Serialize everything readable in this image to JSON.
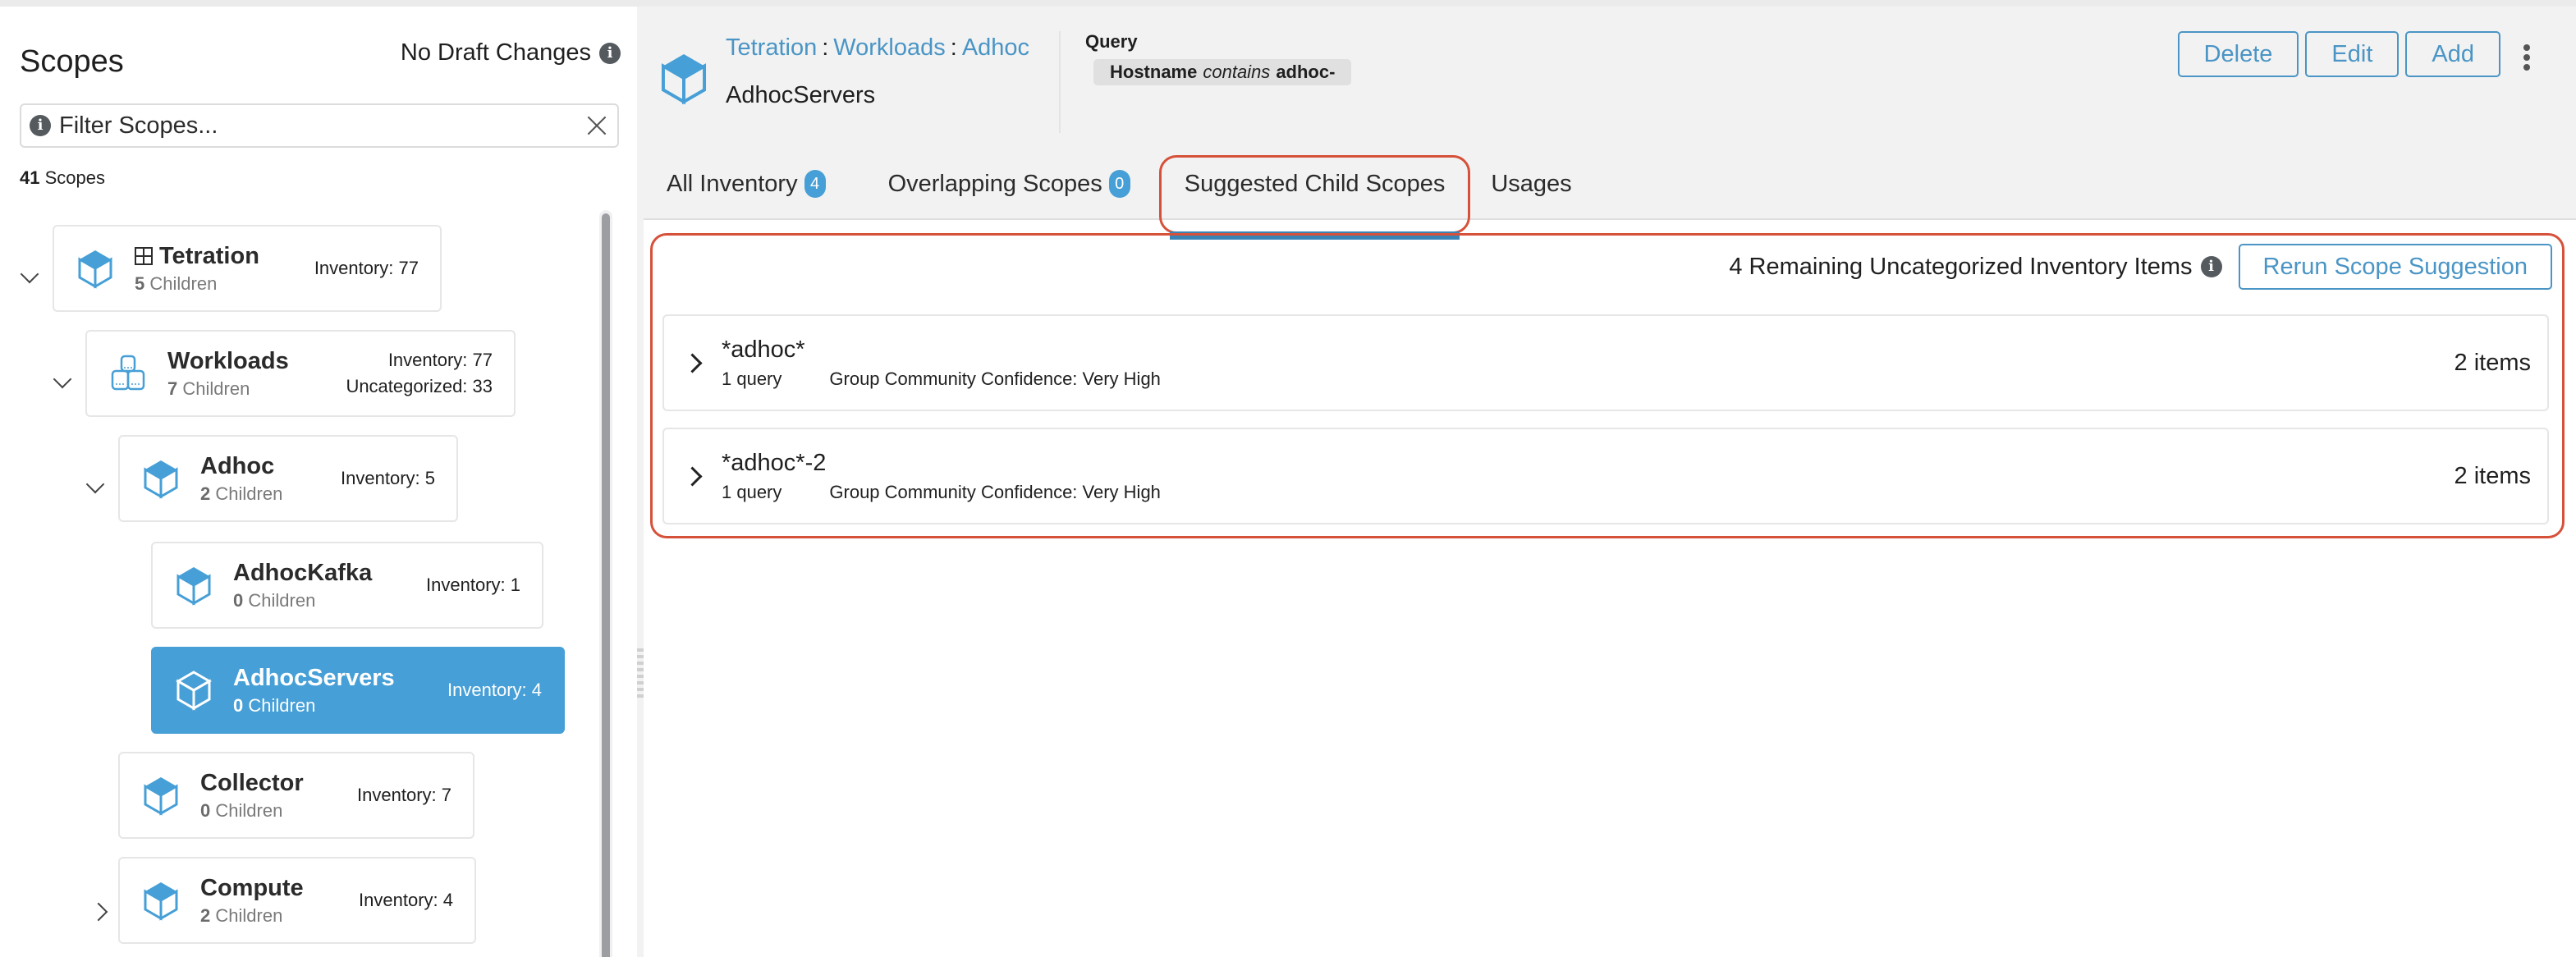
{
  "sidebar": {
    "title": "Scopes",
    "draft_status": "No Draft Changes",
    "filter": {
      "placeholder": "Filter Scopes...",
      "value": ""
    },
    "scope_count": "41",
    "scope_count_label": "Scopes",
    "tree": [
      {
        "name": "Tetration",
        "children_count": "5",
        "children_label": "Children",
        "inventory": "Inventory: 77",
        "uncategorized": null,
        "expanded": true,
        "icon": "cube-icon",
        "root_badge": "grid-icon"
      },
      {
        "name": "Workloads",
        "children_count": "7",
        "children_label": "Children",
        "inventory": "Inventory: 77",
        "uncategorized": "Uncategorized: 33",
        "expanded": true,
        "icon": "stacked-boxes-icon"
      },
      {
        "name": "Adhoc",
        "children_count": "2",
        "children_label": "Children",
        "inventory": "Inventory: 5",
        "expanded": true,
        "icon": "cube-icon"
      },
      {
        "name": "AdhocKafka",
        "children_count": "0",
        "children_label": "Children",
        "inventory": "Inventory: 1",
        "icon": "cube-icon"
      },
      {
        "name": "AdhocServers",
        "children_count": "0",
        "children_label": "Children",
        "inventory": "Inventory: 4",
        "selected": true,
        "icon": "cube-icon"
      },
      {
        "name": "Collector",
        "children_count": "0",
        "children_label": "Children",
        "inventory": "Inventory: 7",
        "icon": "cube-icon"
      },
      {
        "name": "Compute",
        "children_count": "2",
        "children_label": "Children",
        "inventory": "Inventory: 4",
        "expanded": false,
        "icon": "cube-icon"
      }
    ]
  },
  "header": {
    "breadcrumb": [
      "Tetration",
      "Workloads",
      "Adhoc"
    ],
    "breadcrumb_separator": ":",
    "scope_name": "AdhocServers",
    "query_label": "Query",
    "query": {
      "field": "Hostname",
      "operator": "contains",
      "value": "adhoc-"
    },
    "actions": {
      "delete": "Delete",
      "edit": "Edit",
      "add": "Add"
    }
  },
  "tabs": [
    {
      "label": "All Inventory",
      "badge": "4"
    },
    {
      "label": "Overlapping Scopes",
      "badge": "0"
    },
    {
      "label": "Suggested Child Scopes",
      "active": true
    },
    {
      "label": "Usages"
    }
  ],
  "suggestions": {
    "remaining_text": "4 Remaining Uncategorized Inventory Items",
    "rerun_label": "Rerun Scope Suggestion",
    "items": [
      {
        "name": "*adhoc*",
        "queries": "1 query",
        "confidence": "Group Community Confidence: Very High",
        "count": "2 items"
      },
      {
        "name": "*adhoc*-2",
        "queries": "1 query",
        "confidence": "Group Community Confidence: Very High",
        "count": "2 items"
      }
    ]
  },
  "colors": {
    "accent": "#469fd6",
    "link": "#4a95c5",
    "highlight_annotation": "#d6513a",
    "tab_indicator": "#3a83b5"
  }
}
